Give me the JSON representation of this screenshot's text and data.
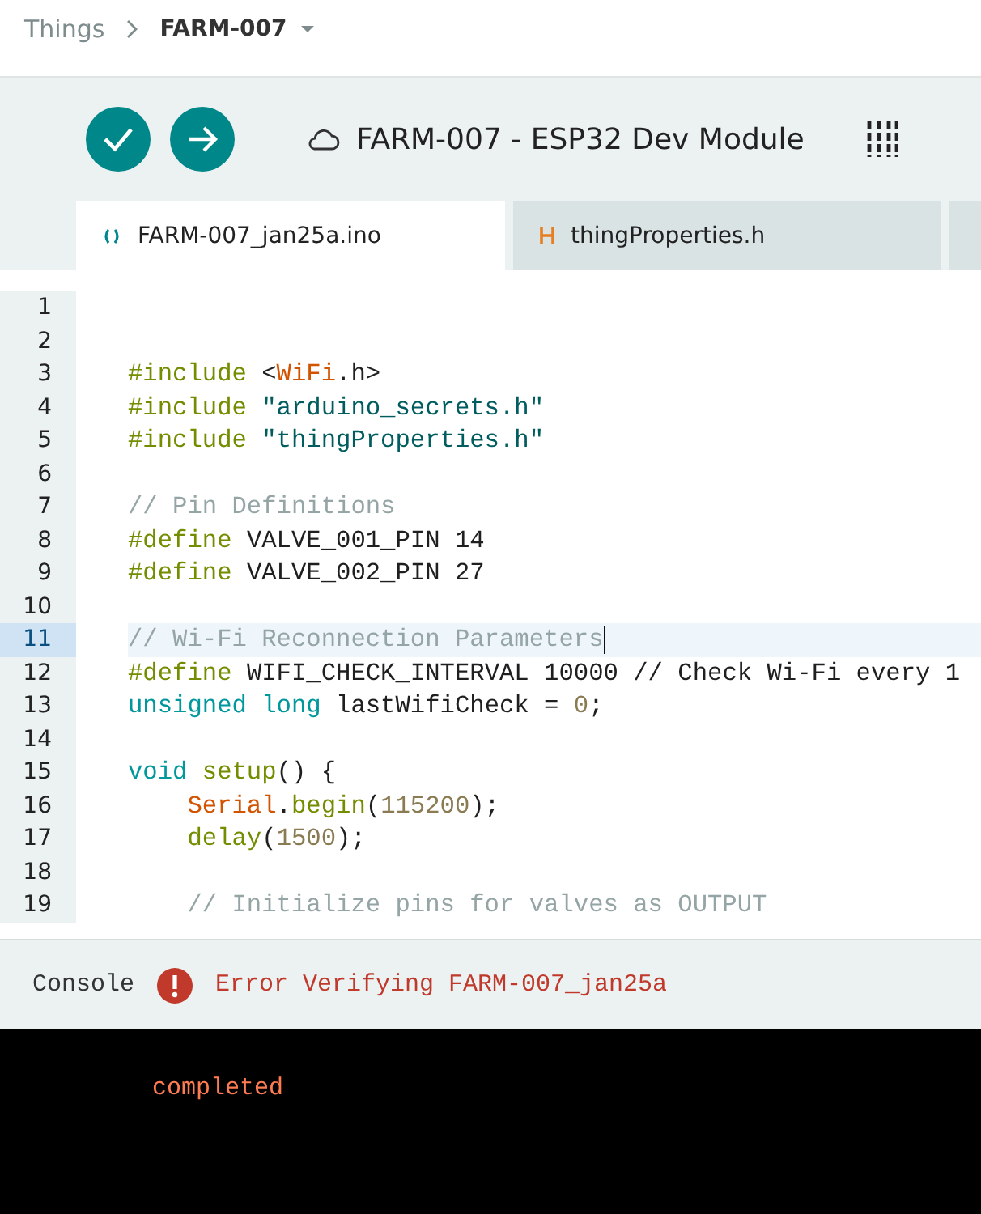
{
  "breadcrumb": [
    {
      "label": "Things",
      "current": false
    },
    {
      "label": "FARM-007",
      "current": true
    }
  ],
  "toolbar": {
    "board_title": "FARM-007 - ESP32 Dev Module"
  },
  "tabs": [
    {
      "label": "FARM-007_jan25a.ino",
      "kind": "sketch",
      "selected": true
    },
    {
      "label": "thingProperties.h",
      "kind": "header",
      "selected": false
    },
    {
      "kind": "more",
      "selected": false
    }
  ],
  "editor": {
    "lines": [
      {
        "number": "1",
        "current": false
      },
      {
        "number": "2",
        "current": false
      },
      {
        "number": "3",
        "current": false,
        "tokens": [
          {
            "text": "#include",
            "kind": "directive"
          },
          {
            "text": " <",
            "kind": "plain"
          },
          {
            "text": "WiFi",
            "kind": "class"
          },
          {
            "text": ".h>",
            "kind": "plain"
          }
        ]
      },
      {
        "number": "4",
        "current": false,
        "tokens": [
          {
            "text": "#include",
            "kind": "directive"
          },
          {
            "text": " \"arduino_secrets.h\"",
            "kind": "string"
          }
        ]
      },
      {
        "number": "5",
        "current": false,
        "tokens": [
          {
            "text": "#include",
            "kind": "directive"
          },
          {
            "text": " \"thingProperties.h\"",
            "kind": "string"
          }
        ]
      },
      {
        "number": "6",
        "current": false
      },
      {
        "number": "7",
        "current": false,
        "tokens": [
          {
            "text": "// Pin Definitions",
            "kind": "comment"
          }
        ]
      },
      {
        "number": "8",
        "current": false,
        "tokens": [
          {
            "text": "#define",
            "kind": "directive"
          },
          {
            "text": " VALVE_001_PIN 14",
            "kind": "plain"
          }
        ]
      },
      {
        "number": "9",
        "current": false,
        "tokens": [
          {
            "text": "#define",
            "kind": "directive"
          },
          {
            "text": " VALVE_002_PIN 27",
            "kind": "plain"
          }
        ]
      },
      {
        "number": "10",
        "current": false
      },
      {
        "number": "11",
        "current": true,
        "tokens": [
          {
            "text": "// Wi-Fi Reconnection Parameters",
            "kind": "comment"
          }
        ]
      },
      {
        "number": "12",
        "current": false,
        "tokens": [
          {
            "text": "#define",
            "kind": "directive"
          },
          {
            "text": " WIFI_CHECK_INTERVAL 10000 // Check Wi-Fi every 1",
            "kind": "plain"
          }
        ]
      },
      {
        "number": "13",
        "current": false,
        "tokens": [
          {
            "text": "unsigned long",
            "kind": "type"
          },
          {
            "text": " lastWifiCheck = ",
            "kind": "plain"
          },
          {
            "text": "0",
            "kind": "number"
          },
          {
            "text": ";",
            "kind": "plain"
          }
        ]
      },
      {
        "number": "14",
        "current": false
      },
      {
        "number": "15",
        "current": false,
        "tokens": [
          {
            "text": "void",
            "kind": "type"
          },
          {
            "text": " setup",
            "kind": "function"
          },
          {
            "text": "() {",
            "kind": "plain"
          }
        ]
      },
      {
        "number": "16",
        "current": false,
        "tokens": [
          {
            "text": "    Serial",
            "kind": "class"
          },
          {
            "text": ".",
            "kind": "plain"
          },
          {
            "text": "begin",
            "kind": "function"
          },
          {
            "text": "(",
            "kind": "plain"
          },
          {
            "text": "115200",
            "kind": "number"
          },
          {
            "text": ");",
            "kind": "plain"
          }
        ]
      },
      {
        "number": "17",
        "current": false,
        "tokens": [
          {
            "text": "    delay",
            "kind": "function"
          },
          {
            "text": "(",
            "kind": "plain"
          },
          {
            "text": "1500",
            "kind": "number"
          },
          {
            "text": ");",
            "kind": "plain"
          }
        ]
      },
      {
        "number": "18",
        "current": false
      },
      {
        "number": "19",
        "current": false,
        "tokens": [
          {
            "text": "    // Initialize pins for valves as OUTPUT",
            "kind": "comment"
          }
        ]
      }
    ]
  },
  "console": {
    "title": "Console",
    "status": {
      "text": "Error Verifying FARM-007_jan25a",
      "kind": "error"
    },
    "output": [
      "completed"
    ]
  }
}
